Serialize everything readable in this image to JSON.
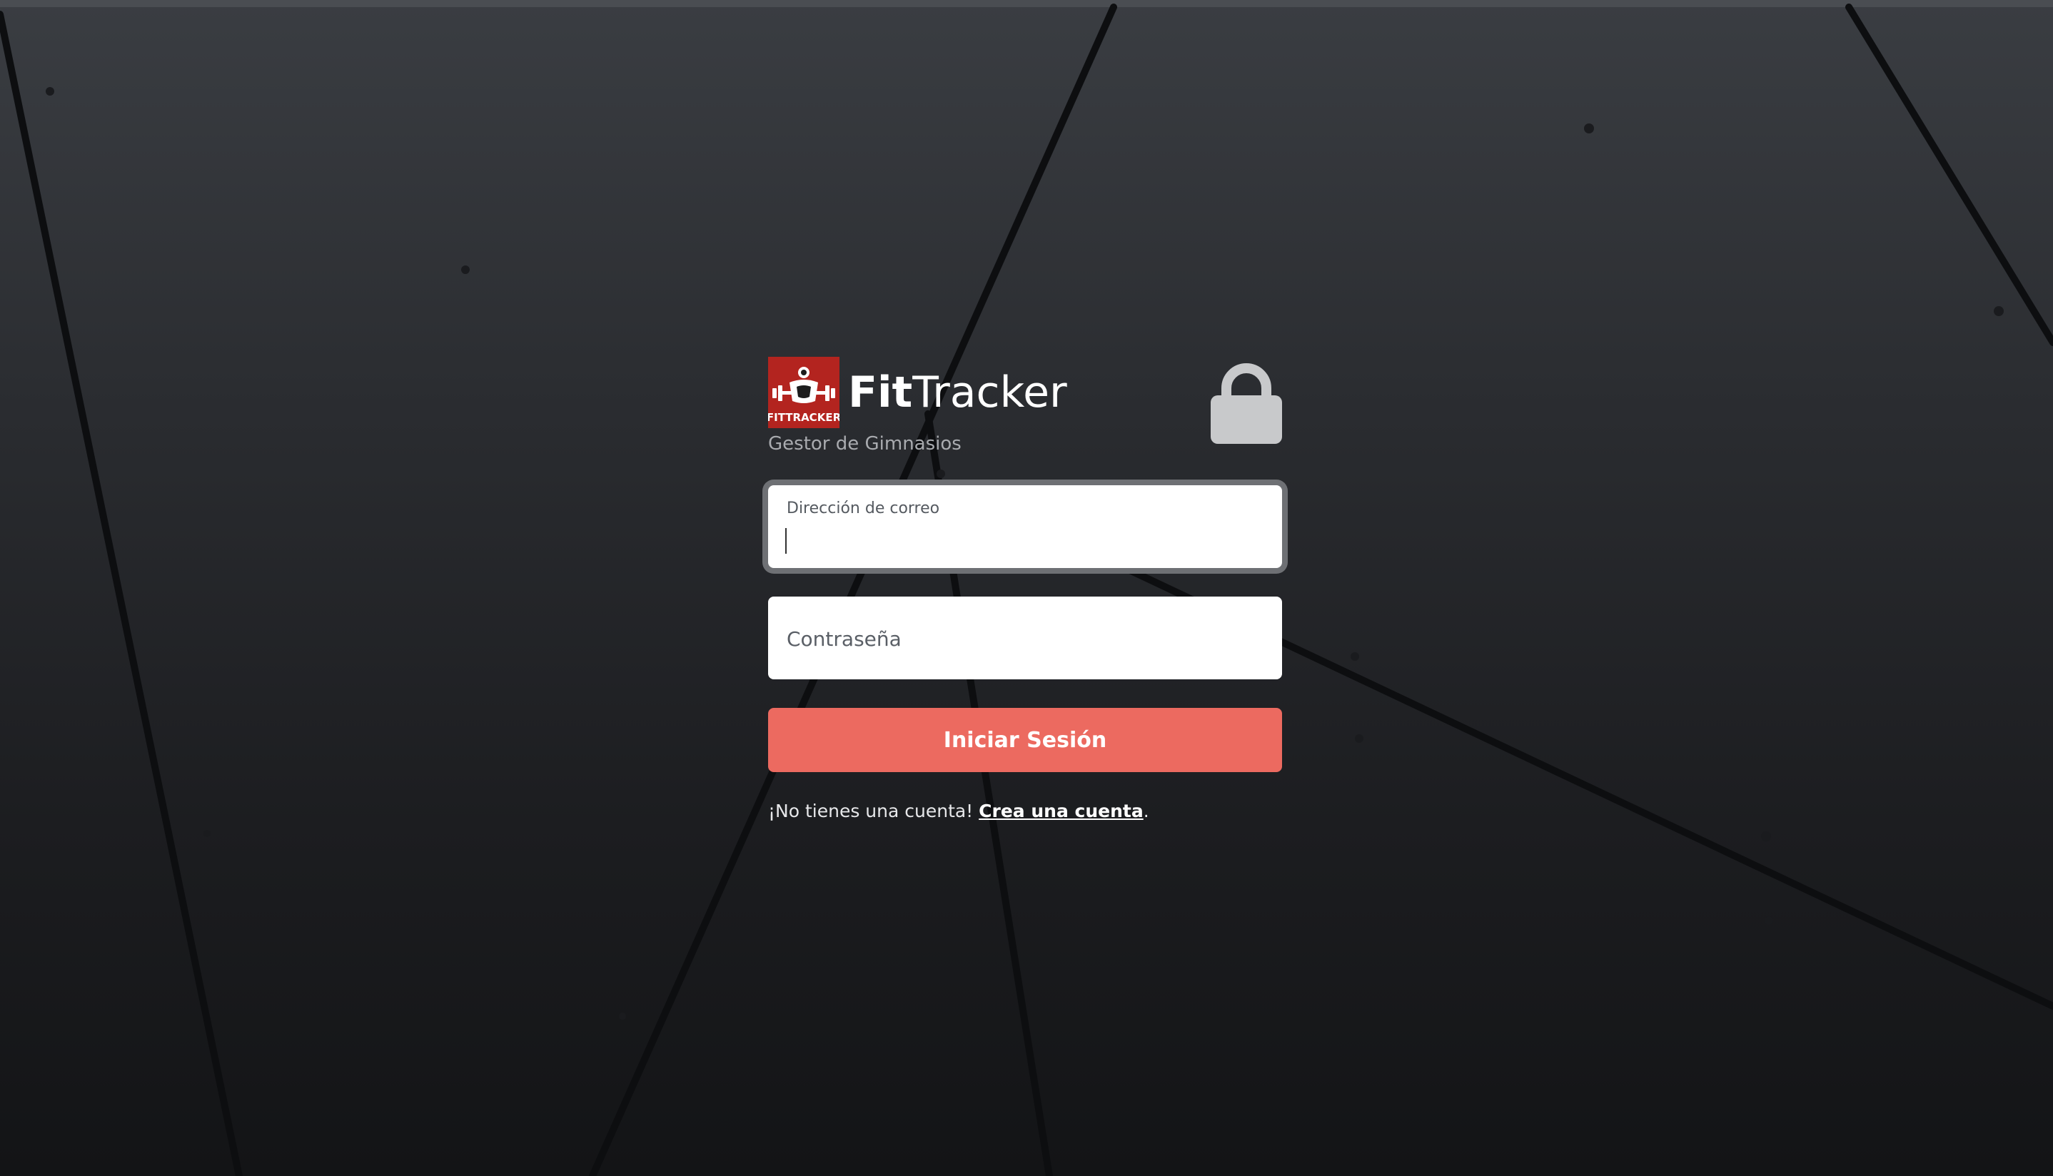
{
  "brand": {
    "logo_text": "FITTRACKER",
    "name_bold": "Fit",
    "name_regular": "Tracker",
    "subtitle": "Gestor de Gimnasios"
  },
  "icons": {
    "lock": "lock-icon",
    "logo": "fittracker-logo"
  },
  "form": {
    "email": {
      "label": "Dirección de correo",
      "value": ""
    },
    "password": {
      "placeholder": "Contraseña",
      "value": ""
    },
    "submit_label": "Iniciar Sesión"
  },
  "signup": {
    "prompt": "¡No tienes una cuenta! ",
    "link_text": "Crea una cuenta",
    "suffix": "."
  },
  "colors": {
    "accent": "#ec6a60",
    "logo_bg": "#b3241f",
    "focus_ring": "#6e7074"
  }
}
